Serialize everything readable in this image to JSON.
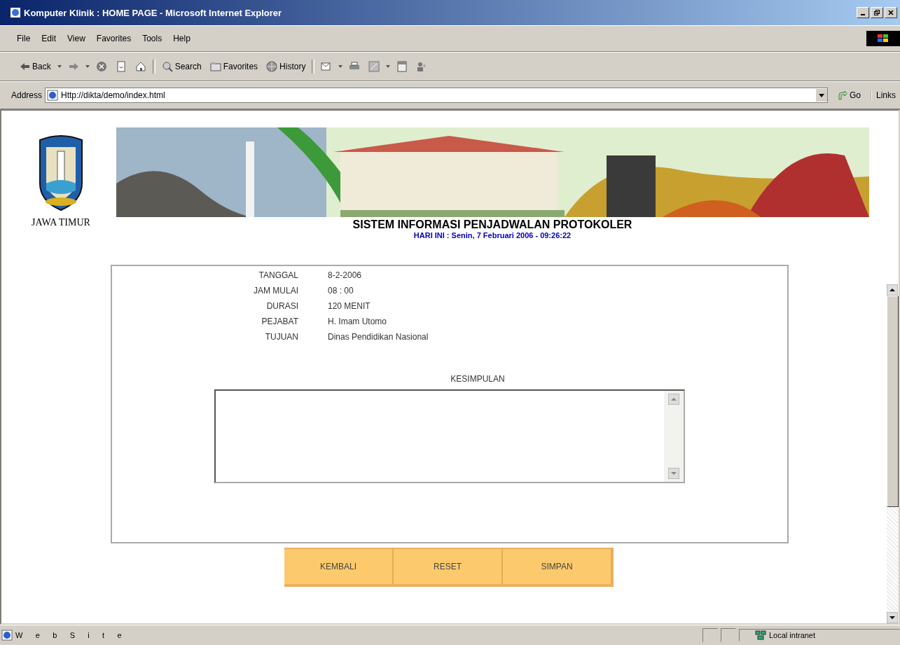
{
  "window": {
    "title": "Komputer Klinik : HOME PAGE - Microsoft Internet Explorer"
  },
  "menu": [
    "File",
    "Edit",
    "View",
    "Favorites",
    "Tools",
    "Help"
  ],
  "toolbar": [
    {
      "kind": "back",
      "label": "Back"
    },
    {
      "kind": "forward"
    },
    {
      "kind": "stop"
    },
    {
      "kind": "refresh"
    },
    {
      "kind": "home"
    },
    {
      "kind": "search",
      "label": "Search"
    },
    {
      "kind": "favorites",
      "label": "Favorites"
    },
    {
      "kind": "history",
      "label": "History"
    },
    {
      "kind": "mail"
    },
    {
      "kind": "print"
    },
    {
      "kind": "edit"
    },
    {
      "kind": "discuss"
    },
    {
      "kind": "messenger"
    }
  ],
  "address": {
    "label": "Address",
    "value": "Http://dikta/demo/index.html",
    "go": "Go",
    "links": "Links"
  },
  "page": {
    "region": "JAWA TIMUR",
    "heading": "SISTEM INFORMASI PENJADWALAN PROTOKOLER",
    "today": "HARI INI : Senin, 7 Februari 2006 - 09:26:22",
    "fields": [
      {
        "label": "TANGGAL",
        "value": "8-2-2006"
      },
      {
        "label": "JAM MULAI",
        "value": "08 : 00"
      },
      {
        "label": "DURASI",
        "value": "120 MENIT"
      },
      {
        "label": "PEJABAT",
        "value": "H. Imam Utomo"
      },
      {
        "label": "TUJUAN",
        "value": "Dinas Pendidikan Nasional"
      }
    ],
    "notes_label": "KESIMPULAN",
    "buttons": [
      "KEMBALI",
      "RESET",
      "SIMPAN"
    ]
  },
  "status_bar": {
    "text": "W      e      b      S      i      t      e",
    "zone": "Local intranet"
  }
}
